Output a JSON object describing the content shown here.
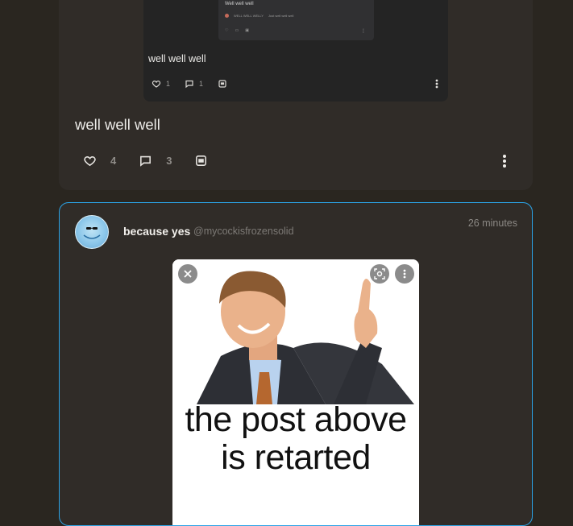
{
  "post_above": {
    "quoted_inner": {
      "nested": {
        "title": "Well well well",
        "meta_author": "WELL WELL WELLY",
        "meta_text": "Just well well well"
      },
      "text": "well well well",
      "like_count": "1",
      "reply_count": "1"
    },
    "text": "well well well",
    "like_count": "4",
    "reply_count": "3"
  },
  "post": {
    "author_name": "because yes",
    "author_handle": "@mycockisfrozensolid",
    "time_ago": "26 minutes",
    "image_caption": "the post above\nis retarted"
  },
  "colors": {
    "background": "#2a2620",
    "card": "#302c28",
    "accent_border": "#2ba3e6",
    "muted": "#8f8c88"
  },
  "icons": [
    "heart-icon",
    "reply-icon",
    "quote-icon",
    "more-icon",
    "close-icon",
    "scan-icon"
  ]
}
